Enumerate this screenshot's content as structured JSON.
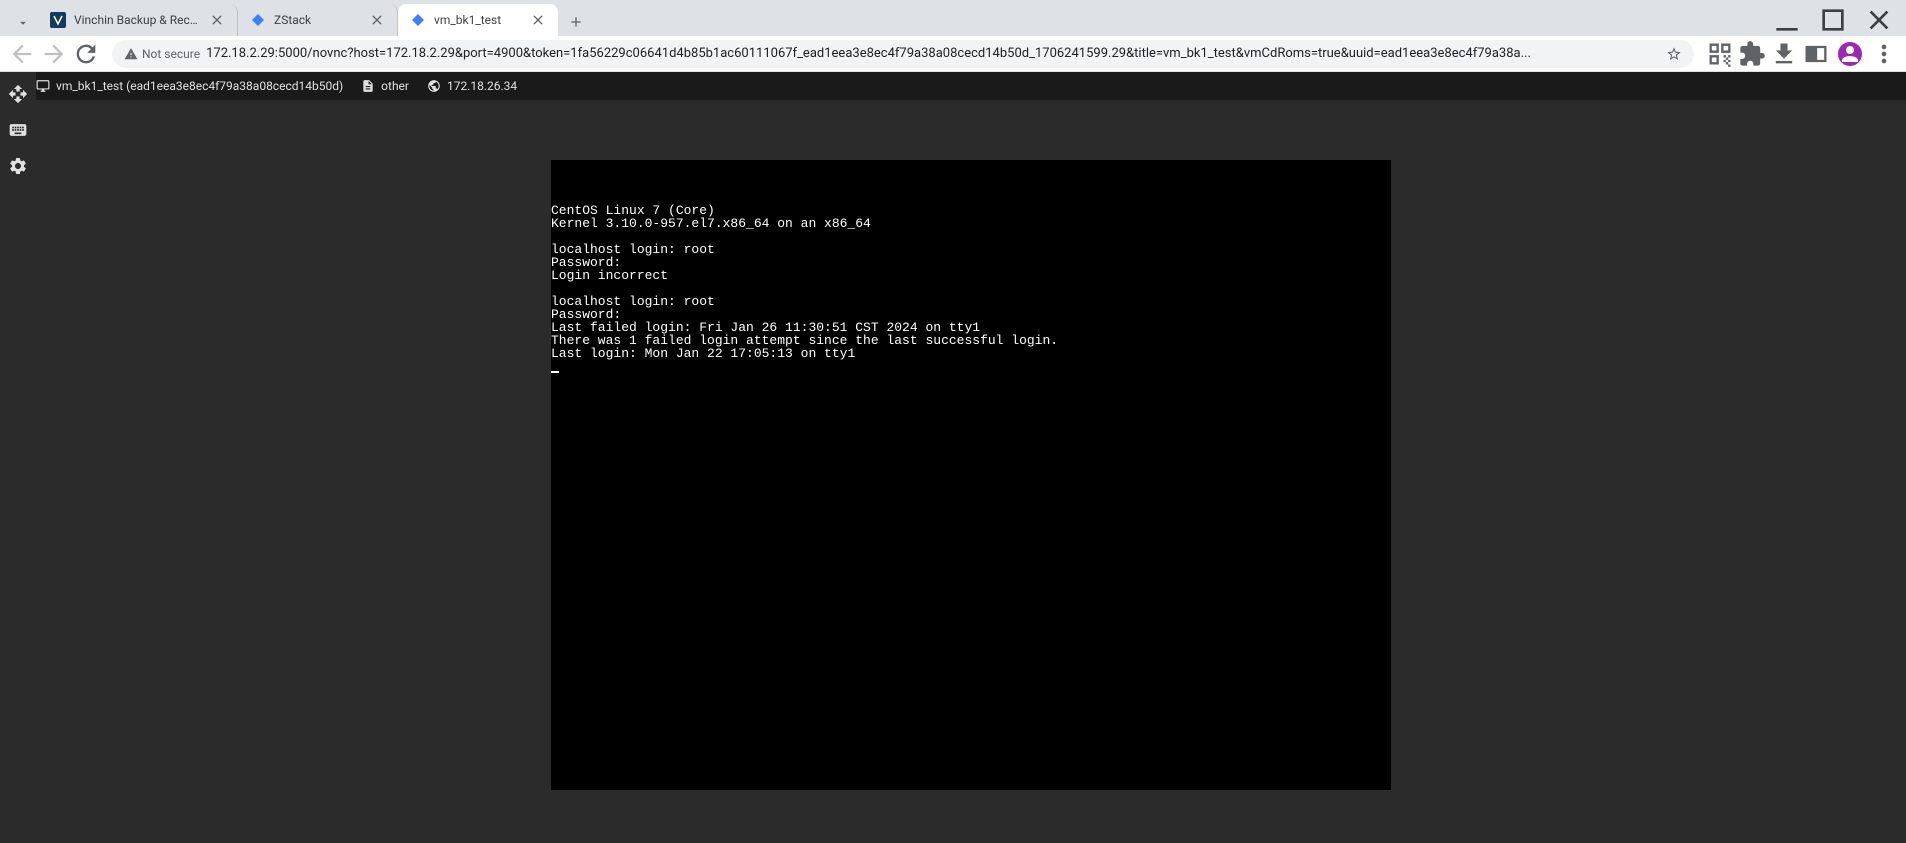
{
  "tabs": [
    {
      "title": "Vinchin Backup & Recovery",
      "icon_bg": "#143a5e"
    },
    {
      "title": "ZStack",
      "icon_bg": "#3b82f6"
    },
    {
      "title": "vm_bk1_test",
      "icon_bg": "#3b82f6",
      "active": true
    }
  ],
  "address_bar": {
    "security_label": "Not secure",
    "url": "172.18.2.29:5000/novnc?host=172.18.2.29&port=4900&token=1fa56229c06641d4b85b1ac60111067f_ead1eea3e8ec4f79a38a08cecd14b50d_1706241599.29&title=vm_bk1_test&vmCdRoms=true&uuid=ead1eea3e8ec4f79a38a..."
  },
  "vm_header": {
    "vm_name": "vm_bk1_test (ead1eea3e8ec4f79a38a08cecd14b50d)",
    "media": "other",
    "ip": "172.18.26.34"
  },
  "console": {
    "lines": [
      "CentOS Linux 7 (Core)",
      "Kernel 3.10.0-957.el7.x86_64 on an x86_64",
      "",
      "localhost login: root",
      "Password:",
      "Login incorrect",
      "",
      "localhost login: root",
      "Password:",
      "Last failed login: Fri Jan 26 11:30:51 CST 2024 on tty1",
      "There was 1 failed login attempt since the last successful login.",
      "Last login: Mon Jan 22 17:05:13 on tty1"
    ]
  }
}
